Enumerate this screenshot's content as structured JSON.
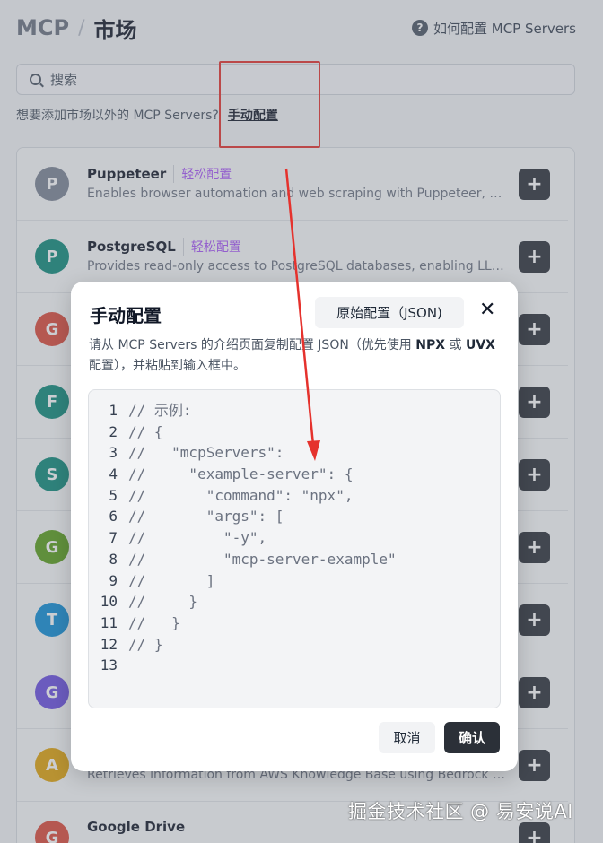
{
  "breadcrumb": {
    "root": "MCP",
    "separator": "/",
    "page": "市场"
  },
  "help": {
    "icon": "question-circle-icon",
    "label": "如何配置 MCP Servers"
  },
  "search": {
    "placeholder": "搜索"
  },
  "hint": {
    "text": "想要添加市场以外的 MCP Servers?",
    "link": "手动配置"
  },
  "servers": [
    {
      "avatar": "P",
      "color": "#7c8494",
      "name": "Puppeteer",
      "tag": "轻松配置",
      "desc": "Enables browser automation and web scraping with Puppeteer, allowing LLMs to interact with web pages"
    },
    {
      "avatar": "P",
      "color": "#0f8a7a",
      "name": "PostgreSQL",
      "tag": "轻松配置",
      "desc": "Provides read-only access to PostgreSQL databases, enabling LLMs to inspect schemas"
    },
    {
      "avatar": "G",
      "color": "#dc4a3a",
      "name": "",
      "tag": "",
      "desc": ""
    },
    {
      "avatar": "F",
      "color": "#0f8a7a",
      "name": "",
      "tag": "",
      "desc": ""
    },
    {
      "avatar": "S",
      "color": "#0f8a7a",
      "name": "",
      "tag": "",
      "desc": ""
    },
    {
      "avatar": "G",
      "color": "#5a9e1a",
      "name": "",
      "tag": "",
      "desc": ""
    },
    {
      "avatar": "T",
      "color": "#0e8ed6",
      "name": "",
      "tag": "",
      "desc": ""
    },
    {
      "avatar": "G",
      "color": "#6a4fe0",
      "name": "",
      "tag": "",
      "desc": ""
    },
    {
      "avatar": "A",
      "color": "#e0a30a",
      "name": "",
      "tag": "",
      "desc": "Retrieves information from AWS Knowledge Base using Bedrock Agent Runtime"
    },
    {
      "avatar": "G",
      "color": "#dc4a3a",
      "name": "Google Drive",
      "tag": "",
      "desc": ""
    }
  ],
  "add_button": "+",
  "modal": {
    "title": "手动配置",
    "json_button": "原始配置（JSON)",
    "close": "✕",
    "desc_pre": "请从 MCP Servers 的介绍页面复制配置 JSON（优先使用 ",
    "desc_npx": "NPX",
    "desc_mid": " 或 ",
    "desc_uvx": "UVX",
    "desc_post": " 配置），并粘贴到输入框中。",
    "code_lines": [
      {
        "n": "1",
        "t": "// 示例:"
      },
      {
        "n": "2",
        "t": "// {"
      },
      {
        "n": "3",
        "t": "//   \"mcpServers\":"
      },
      {
        "n": "4",
        "t": "//     \"example-server\": {"
      },
      {
        "n": "5",
        "t": "//       \"command\": \"npx\","
      },
      {
        "n": "6",
        "t": "//       \"args\": ["
      },
      {
        "n": "7",
        "t": "//         \"-y\","
      },
      {
        "n": "8",
        "t": "//         \"mcp-server-example\""
      },
      {
        "n": "9",
        "t": "//       ]"
      },
      {
        "n": "10",
        "t": "//     }"
      },
      {
        "n": "11",
        "t": "//   }"
      },
      {
        "n": "12",
        "t": "// }"
      },
      {
        "n": "13",
        "t": ""
      }
    ],
    "cancel": "取消",
    "confirm": "确认"
  },
  "watermark": "掘金技术社区 @ 易安说AI",
  "colors": {
    "annotation_red": "#e5322d",
    "primary_dark": "#2b3038",
    "tag_purple": "#a855f7"
  }
}
